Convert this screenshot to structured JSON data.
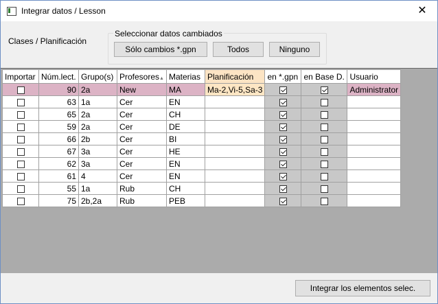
{
  "window": {
    "title": "Integrar datos / Lesson",
    "close": "✕"
  },
  "section_label": "Clases / Planificación",
  "group": {
    "title": "Seleccionar datos cambiados",
    "buttons": [
      "Sólo cambios *.gpn",
      "Todos",
      "Ninguno"
    ]
  },
  "columns": [
    "Importar",
    "Núm.lect.",
    "Grupo(s)",
    "Profesores",
    "Materias",
    "Planificación",
    "en *.gpn",
    "en Base D.",
    "Usuario"
  ],
  "rows": [
    {
      "importar": false,
      "num": "90",
      "grupo": "2a",
      "prof": "New",
      "mat": "MA",
      "plan": "Ma-2,Vi-5,Sa-3",
      "gpn": true,
      "base": true,
      "usuario": "Administrator",
      "selected": true
    },
    {
      "importar": false,
      "num": "63",
      "grupo": "1a",
      "prof": "Cer",
      "mat": "EN",
      "plan": "",
      "gpn": true,
      "base": false,
      "usuario": ""
    },
    {
      "importar": false,
      "num": "65",
      "grupo": "2a",
      "prof": "Cer",
      "mat": "CH",
      "plan": "",
      "gpn": true,
      "base": false,
      "usuario": ""
    },
    {
      "importar": false,
      "num": "59",
      "grupo": "2a",
      "prof": "Cer",
      "mat": "DE",
      "plan": "",
      "gpn": true,
      "base": false,
      "usuario": ""
    },
    {
      "importar": false,
      "num": "66",
      "grupo": "2b",
      "prof": "Cer",
      "mat": "BI",
      "plan": "",
      "gpn": true,
      "base": false,
      "usuario": ""
    },
    {
      "importar": false,
      "num": "67",
      "grupo": "3a",
      "prof": "Cer",
      "mat": "HE",
      "plan": "",
      "gpn": true,
      "base": false,
      "usuario": ""
    },
    {
      "importar": false,
      "num": "62",
      "grupo": "3a",
      "prof": "Cer",
      "mat": "EN",
      "plan": "",
      "gpn": true,
      "base": false,
      "usuario": ""
    },
    {
      "importar": false,
      "num": "61",
      "grupo": "4",
      "prof": "Cer",
      "mat": "EN",
      "plan": "",
      "gpn": true,
      "base": false,
      "usuario": ""
    },
    {
      "importar": false,
      "num": "55",
      "grupo": "1a",
      "prof": "Rub",
      "mat": "CH",
      "plan": "",
      "gpn": true,
      "base": false,
      "usuario": ""
    },
    {
      "importar": false,
      "num": "75",
      "grupo": "2b,2a",
      "prof": "Rub",
      "mat": "PEB",
      "plan": "",
      "gpn": true,
      "base": false,
      "usuario": ""
    }
  ],
  "integrate_button": "Integrar los elementos selec.",
  "colors": {
    "selected_row": "#dcb3c5",
    "planning_header": "#fce4c4",
    "gray_column": "#c8c8c8"
  }
}
